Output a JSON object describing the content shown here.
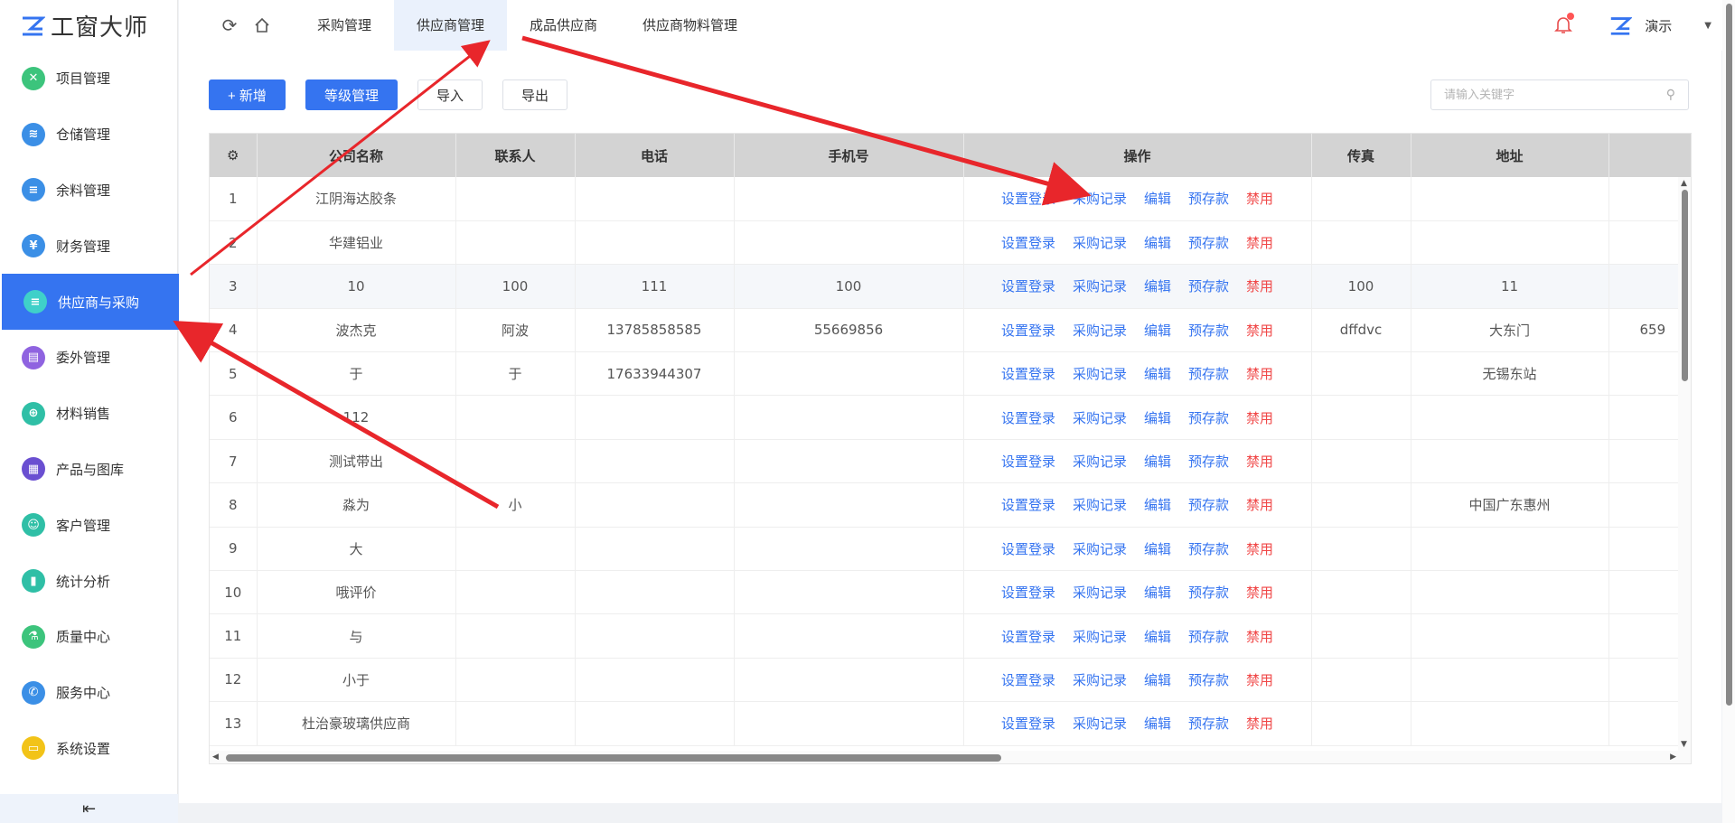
{
  "brand": {
    "name": "工窗大师"
  },
  "sidebar": {
    "items": [
      {
        "label": "项目管理",
        "icon": "project-icon",
        "color": "#3cc47c",
        "glyph": "✕"
      },
      {
        "label": "仓储管理",
        "icon": "warehouse-icon",
        "color": "#3b8fe6",
        "glyph": "≋"
      },
      {
        "label": "余料管理",
        "icon": "material-icon",
        "color": "#3b8fe6",
        "glyph": "≡"
      },
      {
        "label": "财务管理",
        "icon": "finance-icon",
        "color": "#3b8fe6",
        "glyph": "¥"
      },
      {
        "label": "供应商与采购",
        "icon": "supplier-icon",
        "color": "#3fd0c9",
        "glyph": "≡",
        "active": true
      },
      {
        "label": "委外管理",
        "icon": "outsource-icon",
        "color": "#8f63e0",
        "glyph": "▤"
      },
      {
        "label": "材料销售",
        "icon": "sales-icon",
        "color": "#2fbfa6",
        "glyph": "⊕"
      },
      {
        "label": "产品与图库",
        "icon": "gallery-icon",
        "color": "#6a4fd1",
        "glyph": "▦"
      },
      {
        "label": "客户管理",
        "icon": "customer-icon",
        "color": "#2fbfa6",
        "glyph": "☺"
      },
      {
        "label": "统计分析",
        "icon": "stats-icon",
        "color": "#2fbfa6",
        "glyph": "▮"
      },
      {
        "label": "质量中心",
        "icon": "quality-icon",
        "color": "#3cc47c",
        "glyph": "⚗"
      },
      {
        "label": "服务中心",
        "icon": "service-icon",
        "color": "#3b8fe6",
        "glyph": "✆"
      },
      {
        "label": "系统设置",
        "icon": "settings-icon",
        "color": "#f2c318",
        "glyph": "▭"
      }
    ],
    "collapse_glyph": "⇤"
  },
  "header": {
    "tabs": [
      {
        "label": "采购管理"
      },
      {
        "label": "供应商管理",
        "active": true
      },
      {
        "label": "成品供应商"
      },
      {
        "label": "供应商物料管理"
      }
    ],
    "user": "演示"
  },
  "toolbar": {
    "add_label": "+ 新增",
    "level_label": "等级管理",
    "import_label": "导入",
    "export_label": "导出"
  },
  "search": {
    "placeholder": "请输入关键字"
  },
  "table": {
    "columns": [
      "公司名称",
      "联系人",
      "电话",
      "手机号",
      "操作",
      "传真",
      "地址"
    ],
    "actions": [
      "设置登录",
      "采购记录",
      "编辑",
      "预存款",
      "禁用"
    ],
    "rows": [
      {
        "no": "1",
        "company": "江阴海达胶条",
        "contact": "",
        "phone": "",
        "mobile": "",
        "fax": "",
        "address": "",
        "extra": ""
      },
      {
        "no": "2",
        "company": "华建铝业",
        "contact": "",
        "phone": "",
        "mobile": "",
        "fax": "",
        "address": "",
        "extra": ""
      },
      {
        "no": "3",
        "company": "10",
        "contact": "100",
        "phone": "111",
        "mobile": "100",
        "fax": "100",
        "address": "11",
        "extra": ""
      },
      {
        "no": "4",
        "company": "波杰克",
        "contact": "阿波",
        "phone": "13785858585",
        "mobile": "55669856",
        "fax": "dffdvc",
        "address": "大东门",
        "extra": "659"
      },
      {
        "no": "5",
        "company": "于",
        "contact": "于",
        "phone": "17633944307",
        "mobile": "",
        "fax": "",
        "address": "无锡东站",
        "extra": ""
      },
      {
        "no": "6",
        "company": "112",
        "contact": "",
        "phone": "",
        "mobile": "",
        "fax": "",
        "address": "",
        "extra": ""
      },
      {
        "no": "7",
        "company": "测试带出",
        "contact": "",
        "phone": "",
        "mobile": "",
        "fax": "",
        "address": "",
        "extra": ""
      },
      {
        "no": "8",
        "company": "淼为",
        "contact": "小",
        "phone": "",
        "mobile": "",
        "fax": "",
        "address": "中国广东惠州",
        "extra": ""
      },
      {
        "no": "9",
        "company": "大",
        "contact": "",
        "phone": "",
        "mobile": "",
        "fax": "",
        "address": "",
        "extra": ""
      },
      {
        "no": "10",
        "company": "哦评价",
        "contact": "",
        "phone": "",
        "mobile": "",
        "fax": "",
        "address": "",
        "extra": ""
      },
      {
        "no": "11",
        "company": "与",
        "contact": "",
        "phone": "",
        "mobile": "",
        "fax": "",
        "address": "",
        "extra": ""
      },
      {
        "no": "12",
        "company": "小于",
        "contact": "",
        "phone": "",
        "mobile": "",
        "fax": "",
        "address": "",
        "extra": ""
      },
      {
        "no": "13",
        "company": "杜治豪玻璃供应商",
        "contact": "",
        "phone": "",
        "mobile": "",
        "fax": "",
        "address": "",
        "extra": ""
      }
    ]
  },
  "colors": {
    "primary": "#3574f0",
    "danger": "#f04848",
    "arrow": "#e8262b"
  }
}
